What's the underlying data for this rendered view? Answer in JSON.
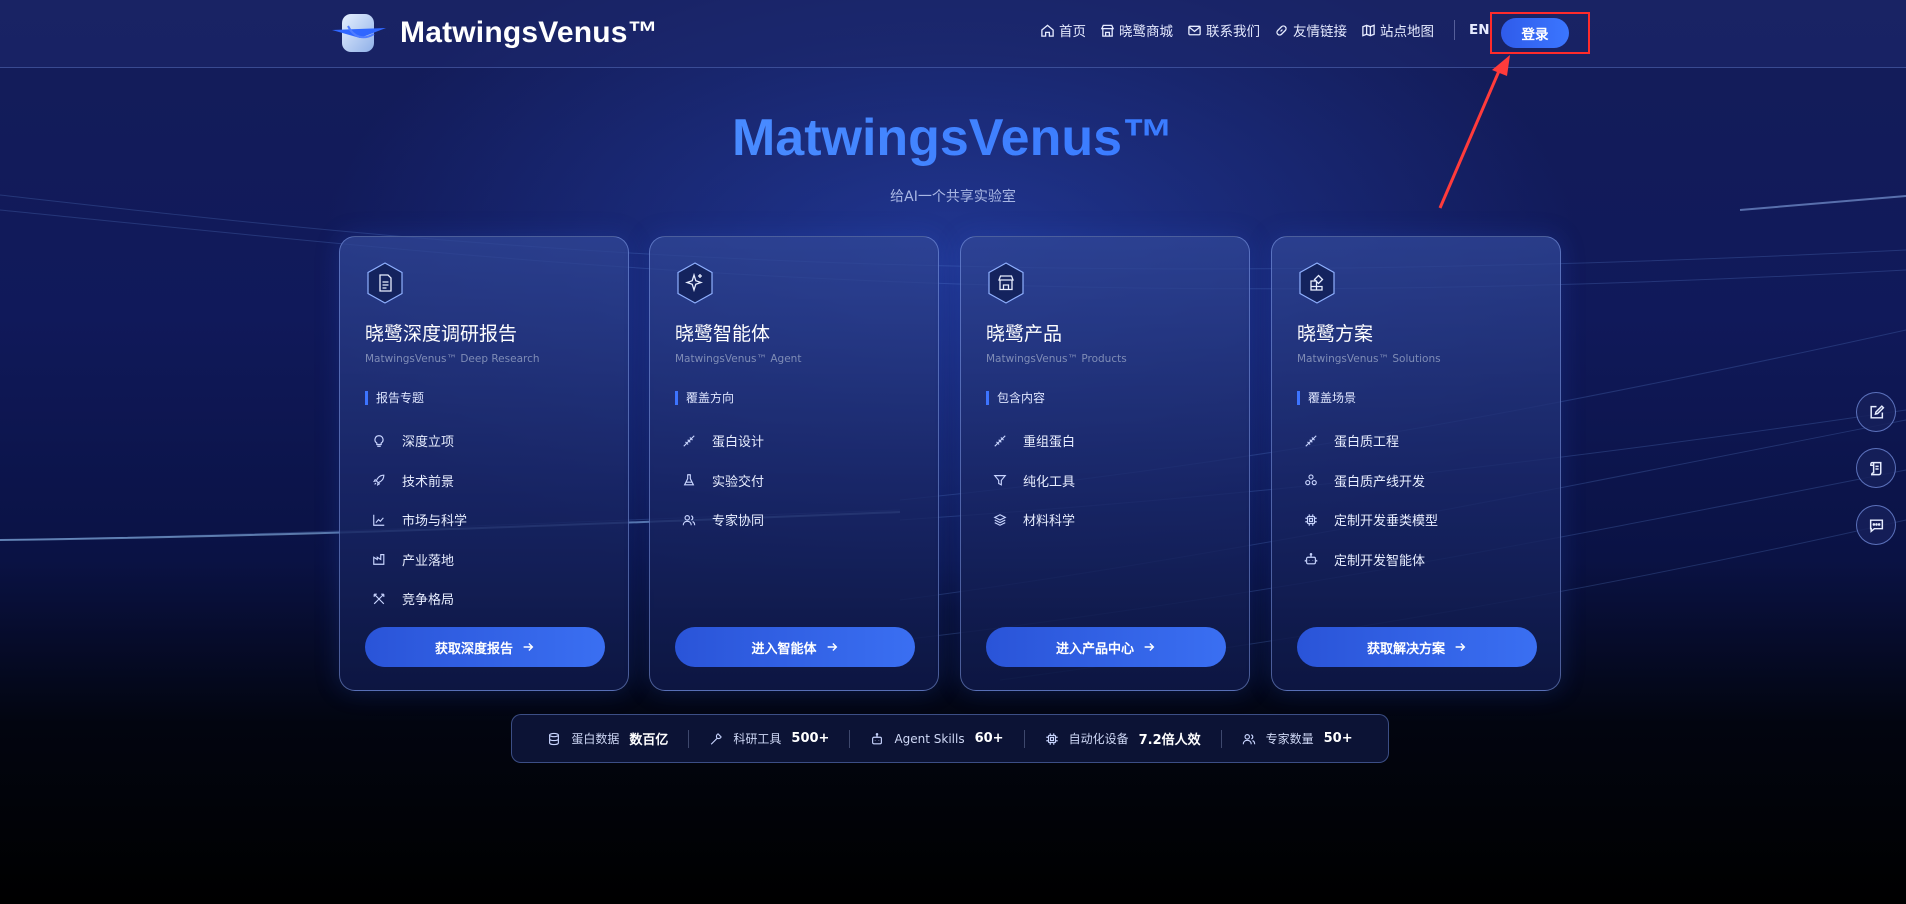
{
  "brand": {
    "name": "MatwingsVenus™"
  },
  "nav": {
    "items": [
      {
        "label": "首页",
        "icon": "home-icon"
      },
      {
        "label": "晓鹭商城",
        "icon": "store-icon"
      },
      {
        "label": "联系我们",
        "icon": "mail-icon"
      },
      {
        "label": "友情链接",
        "icon": "link-icon"
      },
      {
        "label": "站点地图",
        "icon": "map-icon"
      }
    ],
    "lang": "EN",
    "login": "登录"
  },
  "hero": {
    "title": "MatwingsVenus™",
    "subtitle": "给AI一个共享实验室"
  },
  "cards": [
    {
      "title": "晓鹭深度调研报告",
      "subtitle": "MatwingsVenus™ Deep Research",
      "section": "报告专题",
      "items": [
        "深度立项",
        "技术前景",
        "市场与科学",
        "产业落地",
        "竞争格局"
      ],
      "button": "获取深度报告"
    },
    {
      "title": "晓鹭智能体",
      "subtitle": "MatwingsVenus™ Agent",
      "section": "覆盖方向",
      "items": [
        "蛋白设计",
        "实验交付",
        "专家协同"
      ],
      "button": "进入智能体"
    },
    {
      "title": "晓鹭产品",
      "subtitle": "MatwingsVenus™ Products",
      "section": "包含内容",
      "items": [
        "重组蛋白",
        "纯化工具",
        "材料科学"
      ],
      "button": "进入产品中心"
    },
    {
      "title": "晓鹭方案",
      "subtitle": "MatwingsVenus™ Solutions",
      "section": "覆盖场景",
      "items": [
        "蛋白质工程",
        "蛋白质产线开发",
        "定制开发垂类模型",
        "定制开发智能体"
      ],
      "button": "获取解决方案"
    }
  ],
  "stats": [
    {
      "label": "蛋白数据",
      "value": "数百亿",
      "icon": "database-icon"
    },
    {
      "label": "科研工具",
      "value": "500+",
      "icon": "wrench-icon"
    },
    {
      "label": "Agent Skills",
      "value": "60+",
      "icon": "robot-icon"
    },
    {
      "label": "自动化设备",
      "value": "7.2倍人效",
      "icon": "chip-icon"
    },
    {
      "label": "专家数量",
      "value": "50+",
      "icon": "users-icon"
    }
  ],
  "float_buttons": [
    "edit-icon",
    "scroll-icon",
    "chat-icon"
  ],
  "colors": {
    "accent": "#3a6ff2",
    "annotation": "#ff2b2b"
  }
}
